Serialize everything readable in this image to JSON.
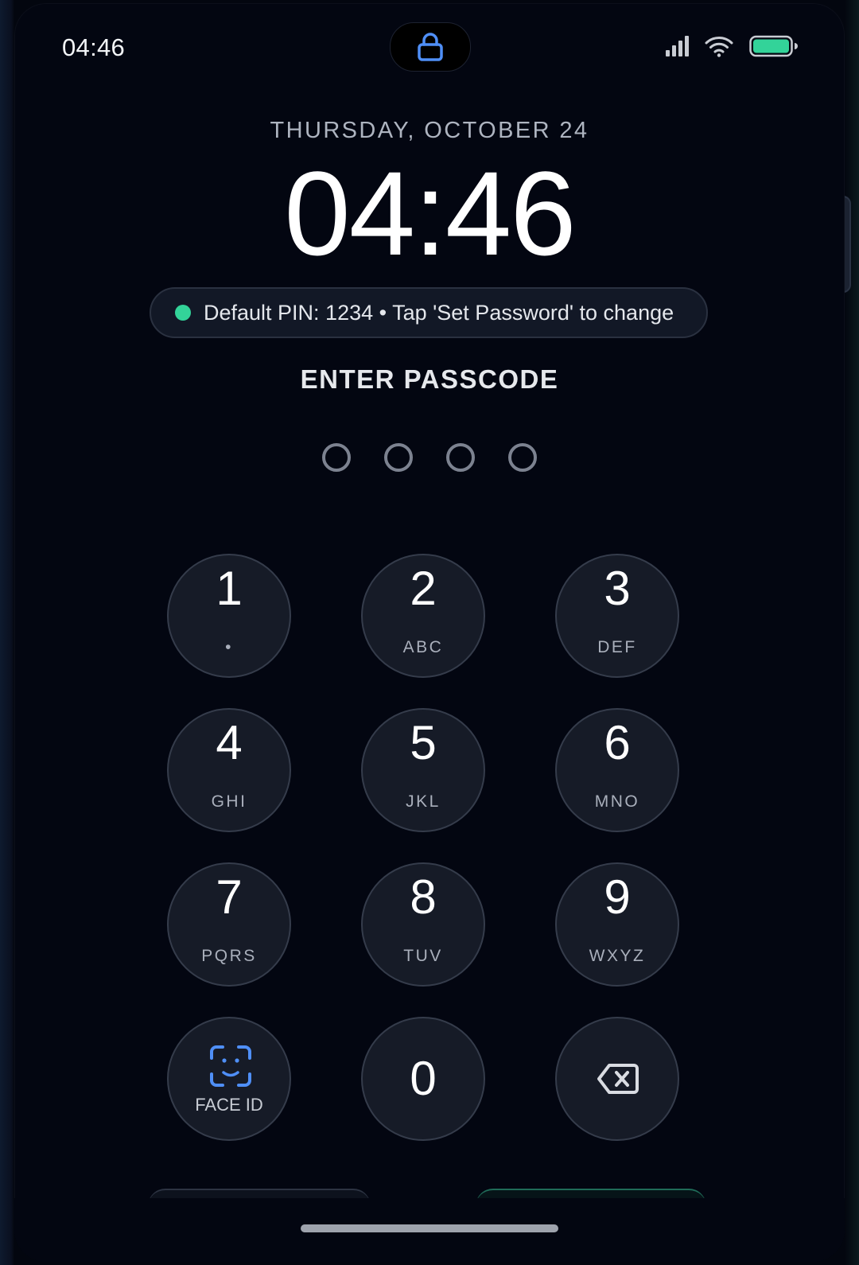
{
  "status_bar": {
    "time": "04:46",
    "icons": [
      "lock-icon",
      "signal-icon",
      "wifi-icon",
      "battery-icon"
    ],
    "battery_color": "#33d399",
    "lock_icon_color": "#4f8ff7"
  },
  "lock_screen": {
    "date": "THURSDAY, OCTOBER 24",
    "time": "04:46",
    "banner": {
      "text": "Default PIN: 1234 • Tap 'Set Password' to change",
      "dot_color": "#33d399"
    },
    "prompt": "ENTER PASSCODE",
    "passcode_length": 4,
    "passcode_filled": 0
  },
  "keypad": {
    "keys": [
      {
        "digit": "1",
        "letters": "•"
      },
      {
        "digit": "2",
        "letters": "ABC"
      },
      {
        "digit": "3",
        "letters": "DEF"
      },
      {
        "digit": "4",
        "letters": "GHI"
      },
      {
        "digit": "5",
        "letters": "JKL"
      },
      {
        "digit": "6",
        "letters": "MNO"
      },
      {
        "digit": "7",
        "letters": "PQRS"
      },
      {
        "digit": "8",
        "letters": "TUV"
      },
      {
        "digit": "9",
        "letters": "WXYZ"
      }
    ],
    "face_id": {
      "label": "FACE ID",
      "icon": "face-id-icon",
      "color": "#4f8ff7"
    },
    "zero": {
      "digit": "0"
    },
    "backspace": {
      "icon": "backspace-icon"
    }
  },
  "accent_color": "#33d399"
}
